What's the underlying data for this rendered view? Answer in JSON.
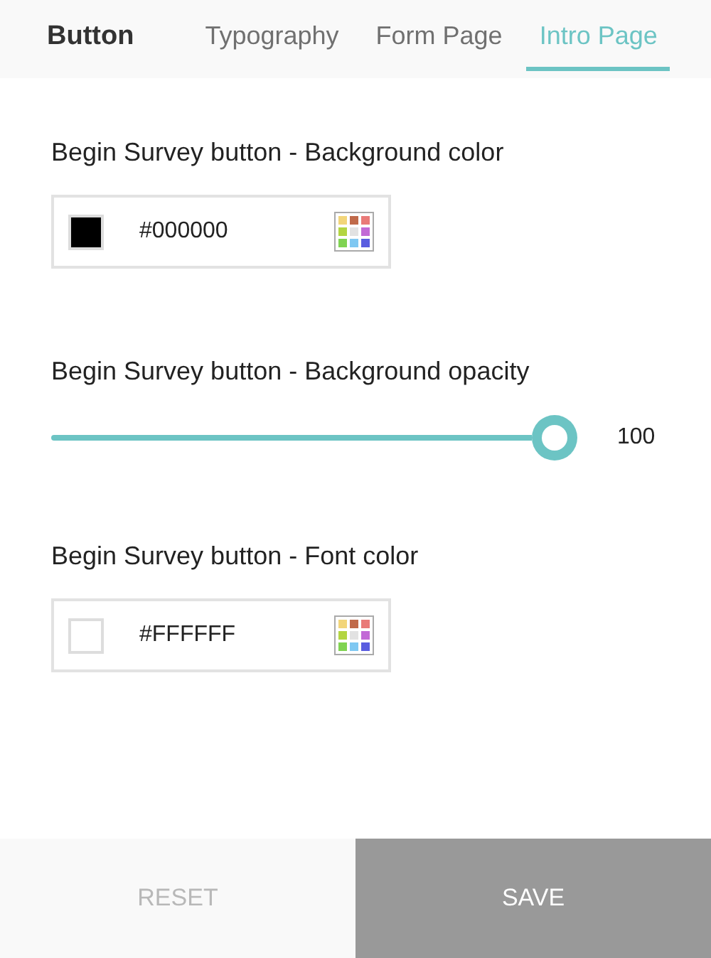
{
  "header": {
    "title": "Button",
    "tabs": [
      {
        "label": "Typography",
        "selected": false
      },
      {
        "label": "Form Page",
        "selected": false
      },
      {
        "label": "Intro Page",
        "selected": true
      }
    ]
  },
  "settings": [
    {
      "kind": "color",
      "label": "Begin Survey button - Background color",
      "value": "#000000"
    },
    {
      "kind": "slider",
      "label": "Begin Survey button - Background opacity",
      "level": 1,
      "reading": "100"
    },
    {
      "kind": "color",
      "label": "Begin Survey button - Font color",
      "value": "#FFFFFF"
    }
  ],
  "buttons": [
    {
      "label": "RESET",
      "kind": "reset",
      "disabled": true
    },
    {
      "label": "SAVE",
      "kind": "save",
      "disabled": false
    }
  ]
}
